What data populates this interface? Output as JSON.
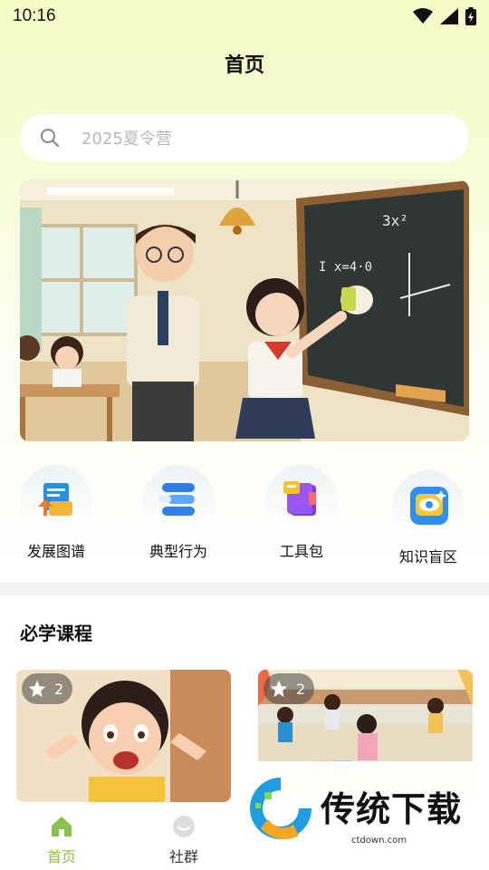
{
  "status_bar": {
    "time": "10:16"
  },
  "header": {
    "title": "首页"
  },
  "search": {
    "placeholder": "2025夏令营"
  },
  "banner": {
    "alt": ""
  },
  "quick_entries": [
    {
      "label": "发展图谱",
      "icon": "growth-map-icon"
    },
    {
      "label": "典型行为",
      "icon": "typical-behavior-icon"
    },
    {
      "label": "工具包",
      "icon": "toolkit-icon"
    },
    {
      "label": "知识盲区",
      "icon": "knowledge-blind-spot-icon"
    }
  ],
  "courses_section": {
    "title": "必学课程",
    "courses": [
      {
        "stars": "2"
      },
      {
        "stars": "2"
      }
    ]
  },
  "tab_bar": {
    "active_color": "#8bc34a",
    "tabs": [
      {
        "label": "首页",
        "icon": "home-icon"
      },
      {
        "label": "社群",
        "icon": "community-icon"
      }
    ]
  },
  "watermark": {
    "title": "传统下载",
    "subtitle": "ctdown.com"
  }
}
